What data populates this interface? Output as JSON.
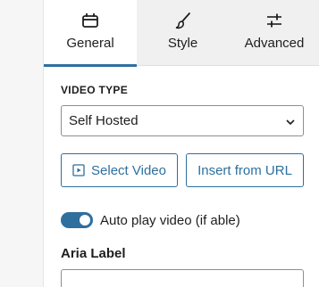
{
  "tabs": [
    {
      "label": "General",
      "icon": "calendar-icon",
      "active": true
    },
    {
      "label": "Style",
      "icon": "brush-icon",
      "active": false
    },
    {
      "label": "Advanced",
      "icon": "sliders-icon",
      "active": false
    }
  ],
  "video_type": {
    "heading": "VIDEO TYPE",
    "selected": "Self Hosted"
  },
  "actions": {
    "select_video": "Select Video",
    "insert_url": "Insert from URL"
  },
  "autoplay": {
    "label": "Auto play video (if able)",
    "enabled": true
  },
  "aria": {
    "label": "Aria Label",
    "value": ""
  },
  "colors": {
    "accent": "#2e6f9e",
    "tab_bg": "#f0f0f1"
  }
}
